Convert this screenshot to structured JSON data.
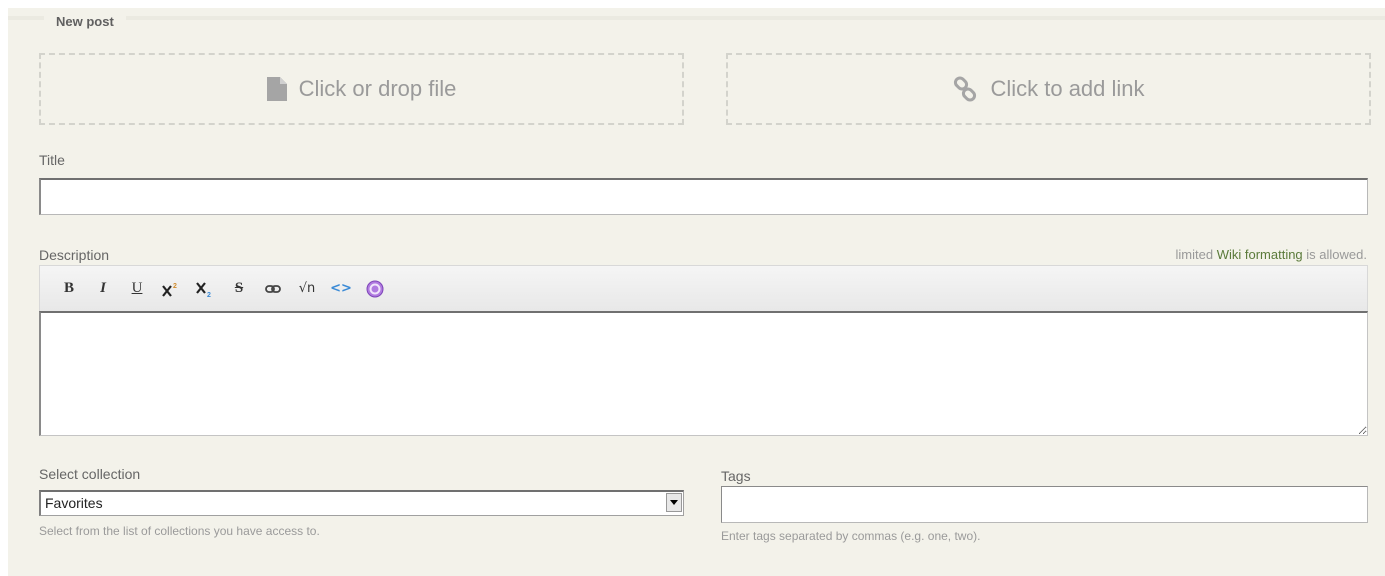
{
  "form": {
    "legend": "New post",
    "file_drop_label": "Click or drop file",
    "link_drop_label": "Click to add link",
    "title_label": "Title",
    "title_value": "",
    "description_label": "Description",
    "wiki_note_prefix": "limited",
    "wiki_note_link": "Wiki formatting",
    "wiki_note_suffix": "is allowed.",
    "description_value": "",
    "collection_label": "Select collection",
    "collection_selected": "Favorites",
    "collection_hint": "Select from the list of collections you have access to.",
    "tags_label": "Tags",
    "tags_value": "",
    "tags_hint": "Enter tags separated by commas (e.g. one, two)."
  },
  "toolbar": {
    "bold": "B",
    "italic": "I",
    "underline": "U",
    "strike": "S",
    "math": "√n",
    "code": "<>"
  },
  "icons": {
    "file": "file-icon",
    "link": "link-icon",
    "help": "help-icon"
  },
  "colors": {
    "panel_bg": "#f3f2ea",
    "code_icon": "#3a8ad6",
    "help_icon": "#9b5fd1",
    "wiki_link": "#5a7a3a"
  }
}
